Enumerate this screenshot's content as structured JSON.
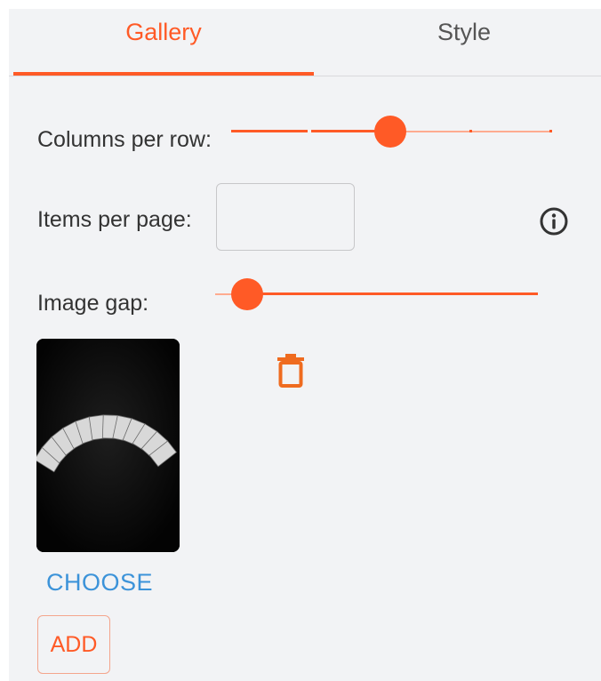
{
  "tabs": [
    {
      "label": "Gallery",
      "active": true
    },
    {
      "label": "Style",
      "active": false
    }
  ],
  "settings": {
    "columns_label": "Columns per row:",
    "items_label": "Items per page:",
    "items_value": "",
    "gap_label": "Image gap:"
  },
  "sliders": {
    "columns": {
      "fraction": 0.5
    },
    "gap": {
      "fraction": 0.06
    }
  },
  "gallery": {
    "choose_label": "CHOOSE",
    "add_label": "ADD"
  },
  "icons": {
    "info": "info-circle-icon",
    "delete": "trash-icon"
  },
  "colors": {
    "accent": "#ff5a26",
    "link": "#3c93d9"
  }
}
